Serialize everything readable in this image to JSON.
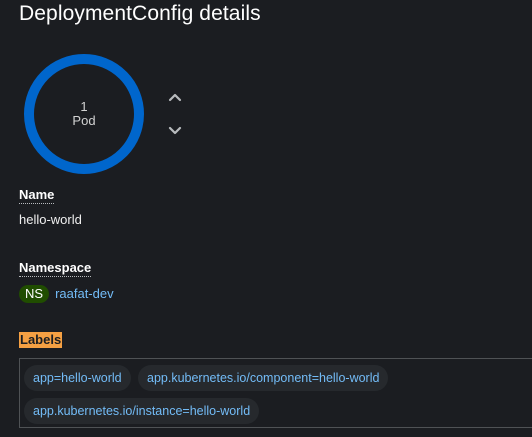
{
  "title": "DeploymentConfig details",
  "pod_ring": {
    "count": "1",
    "unit": "Pod",
    "ready_fraction": 1.0,
    "color": "#0066cc"
  },
  "scale_controls": {
    "up_icon": "chevron-up-icon",
    "down_icon": "chevron-down-icon"
  },
  "fields": {
    "name": {
      "label": "Name",
      "value": "hello-world"
    },
    "namespace": {
      "label": "Namespace",
      "badge": "NS",
      "value": "raafat-dev"
    },
    "labels": {
      "label": "Labels",
      "items": [
        "app=hello-world",
        "app.kubernetes.io/component=hello-world",
        "app.kubernetes.io/instance=hello-world"
      ]
    }
  },
  "colors": {
    "background": "#1b1d21",
    "link": "#73bcf7",
    "ns_badge": "#204d00",
    "highlight": "#f5a043"
  }
}
